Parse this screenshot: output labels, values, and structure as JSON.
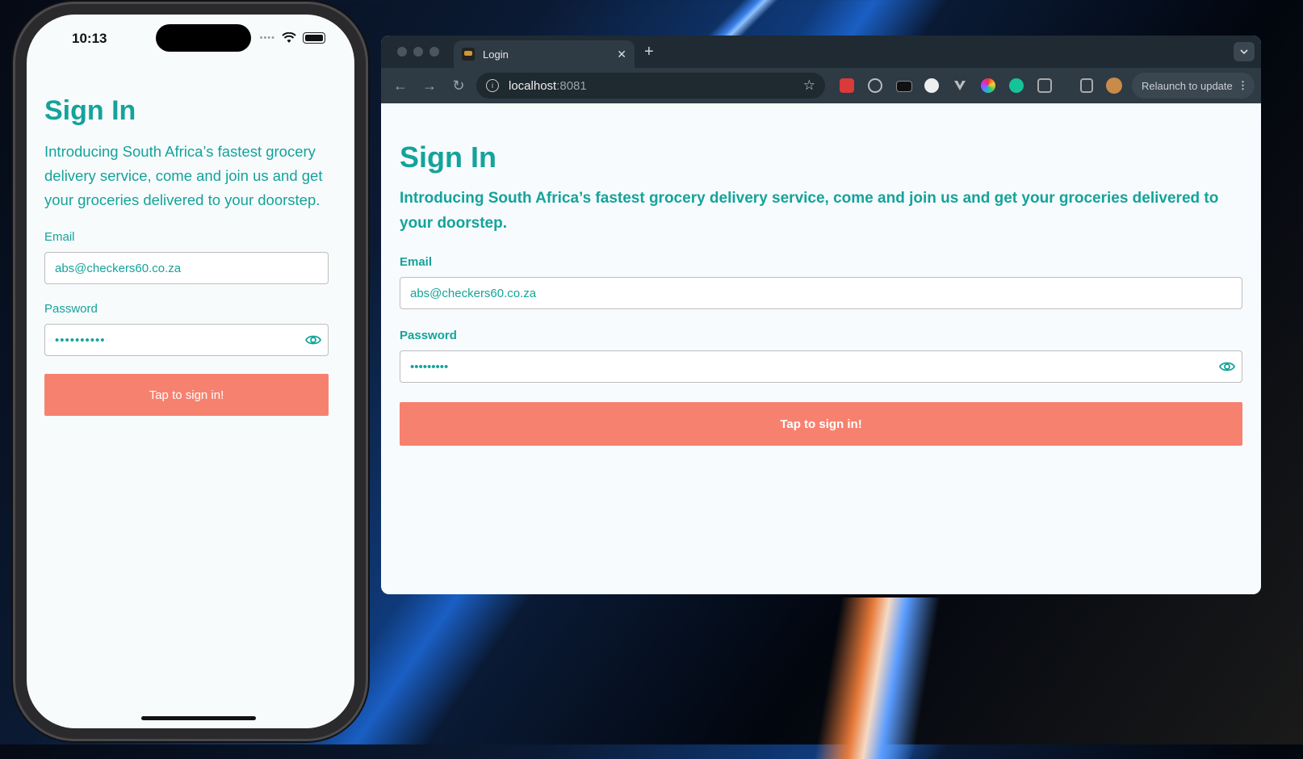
{
  "phone": {
    "time": "10:13",
    "title": "Sign In",
    "intro": "Introducing South Africa’s fastest grocery delivery service, come and join us and get your groceries delivered to your doorstep.",
    "email_label": "Email",
    "email_value": "abs@checkers60.co.za",
    "password_label": "Password",
    "password_value": "••••••••••",
    "submit_label": "Tap to sign in!"
  },
  "browser": {
    "tab_title": "Login",
    "tab_close": "✕",
    "new_tab": "+",
    "url_host": "localhost",
    "url_port": ":8081",
    "relaunch_label": "Relaunch to update",
    "title": "Sign In",
    "intro": "Introducing South Africa’s fastest grocery delivery service, come and join us and get your groceries delivered to your doorstep.",
    "email_label": "Email",
    "email_value": "abs@checkers60.co.za",
    "password_label": "Password",
    "password_value": "•••••••••",
    "submit_label": "Tap to sign in!"
  },
  "colors": {
    "accent": "#14a39b",
    "button": "#f7816f"
  },
  "icons": [
    "back-icon",
    "forward-icon",
    "reload-icon",
    "info-icon",
    "star-icon",
    "eye-icon",
    "extension-icon",
    "profile-avatar",
    "kebab-icon",
    "wifi-icon",
    "battery-icon"
  ]
}
